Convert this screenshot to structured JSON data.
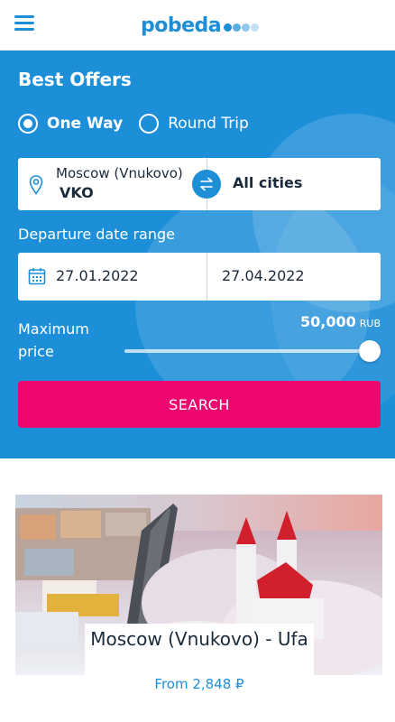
{
  "header": {
    "menu_icon": "hamburger-menu-icon",
    "logo_text": "pobeda",
    "logo_dot_colors": [
      "#1e8fd6",
      "#5aaee4",
      "#8fc6ec",
      "#c2dff4"
    ],
    "brand_color": "#1e8fd6"
  },
  "search": {
    "title": "Best Offers",
    "trip_types": [
      {
        "label": "One Way",
        "selected": true
      },
      {
        "label": "Round Trip",
        "selected": false
      }
    ],
    "from_city": "Moscow (Vnukovo)",
    "from_code": "VKO",
    "to_city": "All cities",
    "date_label": "Departure date range",
    "date_from": "27.01.2022",
    "date_to": "27.04.2022",
    "price_label": "Maximum price",
    "price_value": "50,000",
    "price_currency": "RUB",
    "price_level_fraction": 1.0,
    "search_label": "SEARCH",
    "panel_color": "#1d8fd9",
    "search_button_color": "#f0066f"
  },
  "offers": [
    {
      "route": "Moscow (Vnukovo) - Ufa",
      "price": "From 2,848 ₽"
    }
  ]
}
